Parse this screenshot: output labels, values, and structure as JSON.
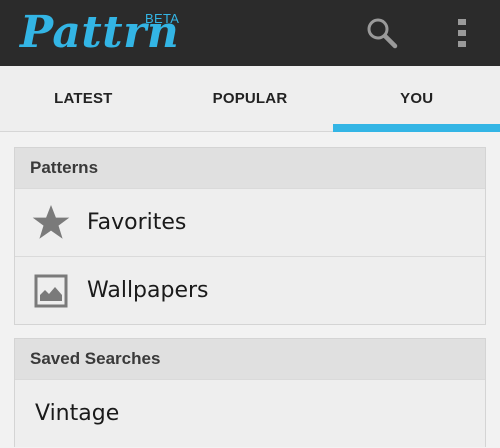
{
  "app": {
    "logo": "Pattrn",
    "badge": "BETA",
    "accent_color": "#33b5e5"
  },
  "actions": {
    "search_icon": "search-icon",
    "overflow_icon": "overflow-menu-icon"
  },
  "tabs": [
    {
      "label": "LATEST",
      "selected": false
    },
    {
      "label": "POPULAR",
      "selected": false
    },
    {
      "label": "YOU",
      "selected": true
    }
  ],
  "patterns": {
    "header": "Patterns",
    "items": [
      {
        "label": "Favorites",
        "icon": "star-icon"
      },
      {
        "label": "Wallpapers",
        "icon": "image-icon"
      }
    ]
  },
  "saved_searches": {
    "header": "Saved Searches",
    "items": [
      {
        "label": "Vintage"
      }
    ]
  }
}
